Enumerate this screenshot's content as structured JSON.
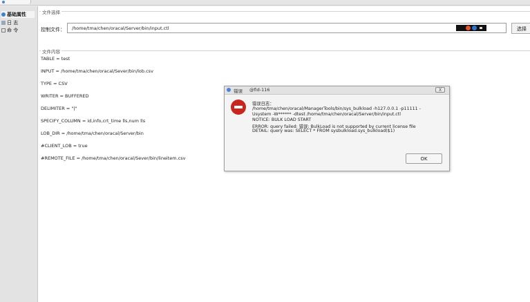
{
  "sidebar": {
    "items": [
      {
        "label": "基础属性"
      },
      {
        "label": "日 志"
      },
      {
        "label": "命 令"
      }
    ]
  },
  "file_select": {
    "group_title": "文件选择",
    "control_file_label": "控制文件：",
    "control_file_value": "/home/tma/chen/oracal/Server/bin/input.ctl",
    "choose_button": "选择"
  },
  "file_content": {
    "group_title": "文件内容",
    "lines": [
      "TABLE = test",
      "INPUT = /home/tma/chen/oracal/Sever/bin/lob.csv",
      "TYPE = CSV",
      "WRITER = BUFFERED",
      "DELIMITER = \"|\"",
      "SPECIFY_COLUMN = id,info,crt_time lls,num lls",
      "LOB_DIR = /home/tma/chen/oracal/Server/bin",
      "#CLIENT_LOB = true",
      "#REMOTE_FILE = /home/tma/chen/oracal/Sever/bin/lineitem.csv"
    ]
  },
  "dialog": {
    "title": "错误",
    "subtitle": "@fid-116",
    "close_label": "X",
    "lines": [
      "错误日志：",
      "/home/tma/chen/oracal/ManagerTools/bin/sys_bulkload -h127.0.0.1 -p11111 -",
      "Usystem -W****** -dtest /home/tma/chen/oracal/Server/bin/input.ctl",
      "NOTICE: BULK LOAD START",
      "ERROR: query failed: 错误:    BulkLoad is not supported by current license file",
      "DETAIL: query was: SELECT * FROM sysbulkload.sys_bulkload($1)"
    ],
    "ok_label": "OK"
  }
}
